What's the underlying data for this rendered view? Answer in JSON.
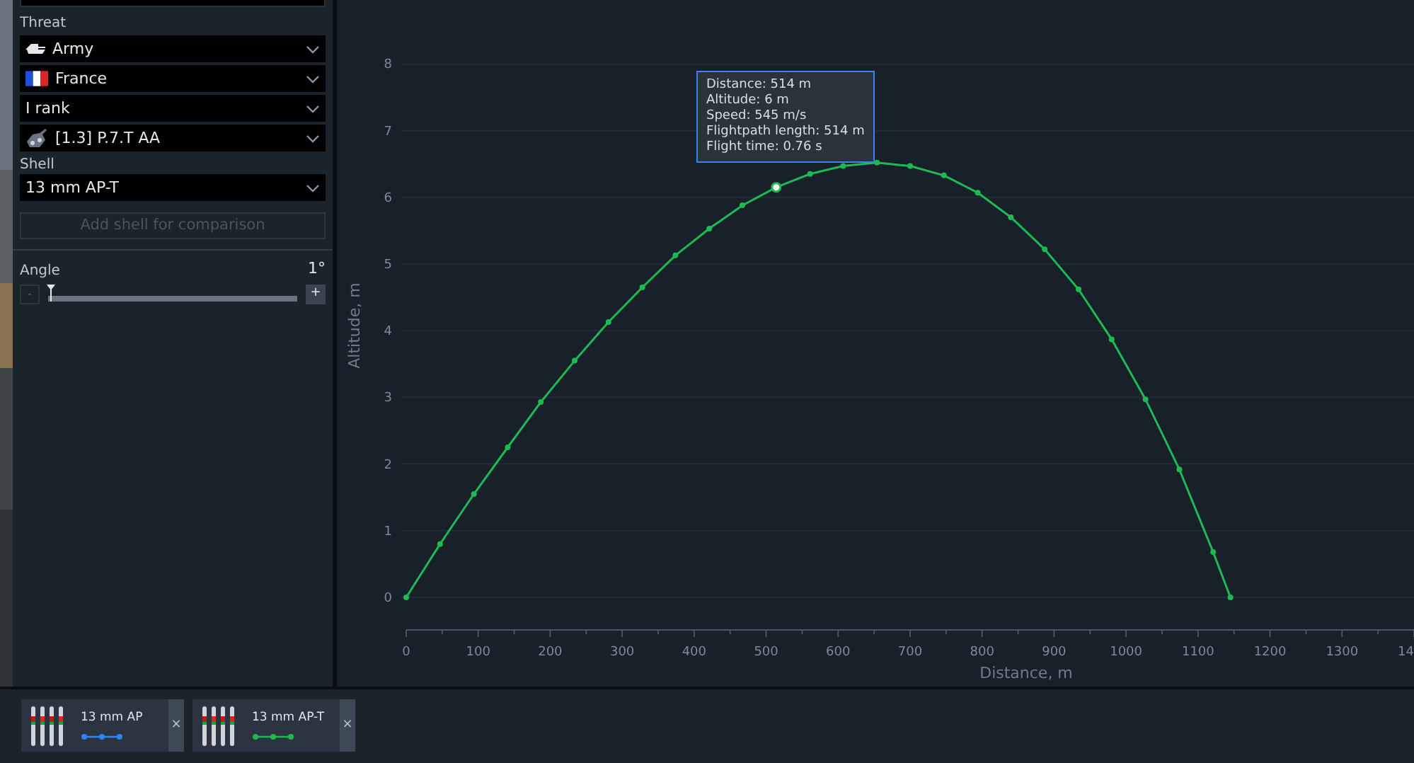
{
  "sidebar": {
    "threat_label": "Threat",
    "selects": [
      {
        "kind": "army",
        "value": "Army"
      },
      {
        "kind": "flag",
        "value": "France"
      },
      {
        "kind": "plain",
        "value": "I rank"
      },
      {
        "kind": "vehicle",
        "value": "[1.3] P.7.T AA"
      }
    ],
    "shell_label": "Shell",
    "shell_select": {
      "value": "13 mm AP-T"
    },
    "add_button": {
      "label": "Add shell for comparison",
      "disabled": true
    },
    "angle": {
      "label": "Angle",
      "reading": "1°",
      "minus": "-",
      "plus": "+",
      "level": 0.01
    }
  },
  "chart": {
    "cut_tick_label": "14",
    "point_states": [
      {
        "hovered": false
      },
      {
        "hovered": false
      },
      {
        "hovered": false
      },
      {
        "hovered": false
      },
      {
        "hovered": false
      },
      {
        "hovered": false
      },
      {
        "hovered": false
      },
      {
        "hovered": false
      },
      {
        "hovered": false
      },
      {
        "hovered": false
      },
      {
        "hovered": false
      },
      {
        "hovered": true
      },
      {
        "hovered": false
      },
      {
        "hovered": false
      },
      {
        "hovered": false
      },
      {
        "hovered": false
      },
      {
        "hovered": false
      },
      {
        "hovered": false
      },
      {
        "hovered": false
      },
      {
        "hovered": false
      },
      {
        "hovered": false
      },
      {
        "hovered": false
      },
      {
        "hovered": false
      },
      {
        "hovered": false
      },
      {
        "hovered": false
      },
      {
        "hovered": false
      }
    ],
    "chart_data": {
      "type": "line",
      "grid": true,
      "annotations": [
        "Distance: 514 m",
        "Altitude: 6 m",
        "Speed: 545 m/s",
        "Flightpath length: 514 m",
        "Flight time: 0.76 s"
      ],
      "xlabel": "Distance, m",
      "ylabel": "Altitude, m",
      "xlim": [
        0,
        1400
      ],
      "ylim": [
        0,
        8
      ],
      "xticks": [
        0,
        100,
        200,
        300,
        400,
        500,
        600,
        700,
        800,
        900,
        1000,
        1100,
        1200,
        1300
      ],
      "yticks": [
        0,
        1,
        2,
        3,
        4,
        5,
        6,
        7,
        8
      ],
      "x": [
        0,
        47,
        94,
        141,
        187,
        234,
        281,
        328,
        374,
        421,
        467,
        514,
        561,
        607,
        654,
        700,
        747,
        794,
        840,
        887,
        934,
        980,
        1027,
        1074,
        1121,
        1145
      ],
      "series": [
        {
          "color": "#1db954",
          "marker": "circle",
          "values": [
            0,
            0.8,
            1.55,
            2.25,
            2.93,
            3.55,
            4.13,
            4.65,
            5.13,
            5.53,
            5.88,
            6.15,
            6.35,
            6.47,
            6.52,
            6.47,
            6.33,
            6.07,
            5.7,
            5.22,
            4.62,
            3.87,
            2.97,
            1.92,
            0.68,
            0
          ]
        }
      ]
    }
  },
  "comparison": [
    {
      "name": "13 mm AP",
      "color": "#2f86f0",
      "close": "×"
    },
    {
      "name": "13 mm AP-T",
      "color": "#1db954",
      "close": "×"
    }
  ]
}
